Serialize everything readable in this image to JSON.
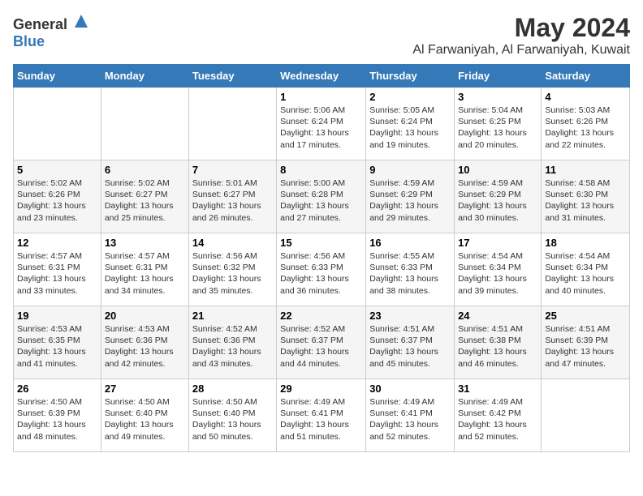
{
  "logo": {
    "general": "General",
    "blue": "Blue"
  },
  "title": "May 2024",
  "location": "Al Farwaniyah, Al Farwaniyah, Kuwait",
  "days_of_week": [
    "Sunday",
    "Monday",
    "Tuesday",
    "Wednesday",
    "Thursday",
    "Friday",
    "Saturday"
  ],
  "weeks": [
    [
      {
        "day": "",
        "info": ""
      },
      {
        "day": "",
        "info": ""
      },
      {
        "day": "",
        "info": ""
      },
      {
        "day": "1",
        "info": "Sunrise: 5:06 AM\nSunset: 6:24 PM\nDaylight: 13 hours and 17 minutes."
      },
      {
        "day": "2",
        "info": "Sunrise: 5:05 AM\nSunset: 6:24 PM\nDaylight: 13 hours and 19 minutes."
      },
      {
        "day": "3",
        "info": "Sunrise: 5:04 AM\nSunset: 6:25 PM\nDaylight: 13 hours and 20 minutes."
      },
      {
        "day": "4",
        "info": "Sunrise: 5:03 AM\nSunset: 6:26 PM\nDaylight: 13 hours and 22 minutes."
      }
    ],
    [
      {
        "day": "5",
        "info": "Sunrise: 5:02 AM\nSunset: 6:26 PM\nDaylight: 13 hours and 23 minutes."
      },
      {
        "day": "6",
        "info": "Sunrise: 5:02 AM\nSunset: 6:27 PM\nDaylight: 13 hours and 25 minutes."
      },
      {
        "day": "7",
        "info": "Sunrise: 5:01 AM\nSunset: 6:27 PM\nDaylight: 13 hours and 26 minutes."
      },
      {
        "day": "8",
        "info": "Sunrise: 5:00 AM\nSunset: 6:28 PM\nDaylight: 13 hours and 27 minutes."
      },
      {
        "day": "9",
        "info": "Sunrise: 4:59 AM\nSunset: 6:29 PM\nDaylight: 13 hours and 29 minutes."
      },
      {
        "day": "10",
        "info": "Sunrise: 4:59 AM\nSunset: 6:29 PM\nDaylight: 13 hours and 30 minutes."
      },
      {
        "day": "11",
        "info": "Sunrise: 4:58 AM\nSunset: 6:30 PM\nDaylight: 13 hours and 31 minutes."
      }
    ],
    [
      {
        "day": "12",
        "info": "Sunrise: 4:57 AM\nSunset: 6:31 PM\nDaylight: 13 hours and 33 minutes."
      },
      {
        "day": "13",
        "info": "Sunrise: 4:57 AM\nSunset: 6:31 PM\nDaylight: 13 hours and 34 minutes."
      },
      {
        "day": "14",
        "info": "Sunrise: 4:56 AM\nSunset: 6:32 PM\nDaylight: 13 hours and 35 minutes."
      },
      {
        "day": "15",
        "info": "Sunrise: 4:56 AM\nSunset: 6:33 PM\nDaylight: 13 hours and 36 minutes."
      },
      {
        "day": "16",
        "info": "Sunrise: 4:55 AM\nSunset: 6:33 PM\nDaylight: 13 hours and 38 minutes."
      },
      {
        "day": "17",
        "info": "Sunrise: 4:54 AM\nSunset: 6:34 PM\nDaylight: 13 hours and 39 minutes."
      },
      {
        "day": "18",
        "info": "Sunrise: 4:54 AM\nSunset: 6:34 PM\nDaylight: 13 hours and 40 minutes."
      }
    ],
    [
      {
        "day": "19",
        "info": "Sunrise: 4:53 AM\nSunset: 6:35 PM\nDaylight: 13 hours and 41 minutes."
      },
      {
        "day": "20",
        "info": "Sunrise: 4:53 AM\nSunset: 6:36 PM\nDaylight: 13 hours and 42 minutes."
      },
      {
        "day": "21",
        "info": "Sunrise: 4:52 AM\nSunset: 6:36 PM\nDaylight: 13 hours and 43 minutes."
      },
      {
        "day": "22",
        "info": "Sunrise: 4:52 AM\nSunset: 6:37 PM\nDaylight: 13 hours and 44 minutes."
      },
      {
        "day": "23",
        "info": "Sunrise: 4:51 AM\nSunset: 6:37 PM\nDaylight: 13 hours and 45 minutes."
      },
      {
        "day": "24",
        "info": "Sunrise: 4:51 AM\nSunset: 6:38 PM\nDaylight: 13 hours and 46 minutes."
      },
      {
        "day": "25",
        "info": "Sunrise: 4:51 AM\nSunset: 6:39 PM\nDaylight: 13 hours and 47 minutes."
      }
    ],
    [
      {
        "day": "26",
        "info": "Sunrise: 4:50 AM\nSunset: 6:39 PM\nDaylight: 13 hours and 48 minutes."
      },
      {
        "day": "27",
        "info": "Sunrise: 4:50 AM\nSunset: 6:40 PM\nDaylight: 13 hours and 49 minutes."
      },
      {
        "day": "28",
        "info": "Sunrise: 4:50 AM\nSunset: 6:40 PM\nDaylight: 13 hours and 50 minutes."
      },
      {
        "day": "29",
        "info": "Sunrise: 4:49 AM\nSunset: 6:41 PM\nDaylight: 13 hours and 51 minutes."
      },
      {
        "day": "30",
        "info": "Sunrise: 4:49 AM\nSunset: 6:41 PM\nDaylight: 13 hours and 52 minutes."
      },
      {
        "day": "31",
        "info": "Sunrise: 4:49 AM\nSunset: 6:42 PM\nDaylight: 13 hours and 52 minutes."
      },
      {
        "day": "",
        "info": ""
      }
    ]
  ]
}
